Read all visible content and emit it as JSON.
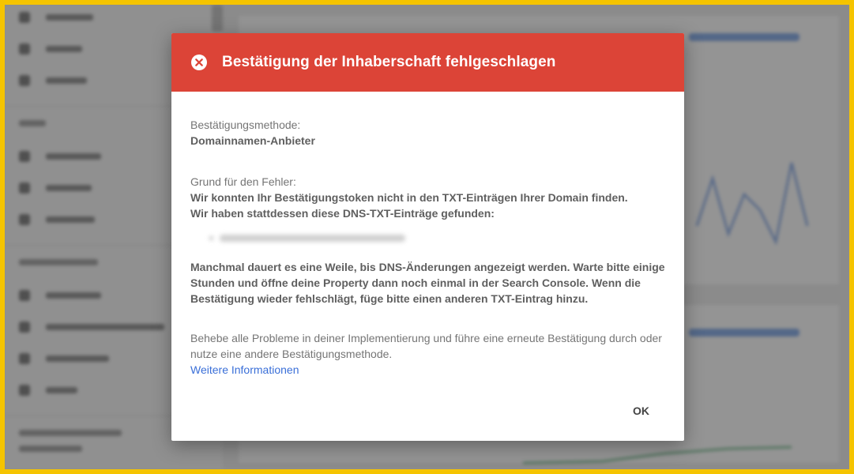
{
  "dialog": {
    "title": "Bestätigung der Inhaberschaft fehlgeschlagen",
    "method_label": "Bestätigungsmethode:",
    "method_value": "Domainnamen-Anbieter",
    "reason_label": "Grund für den Fehler:",
    "reason_line1": "Wir konnten Ihr Bestätigungstoken nicht in den TXT-Einträgen Ihrer Domain finden.",
    "reason_line2": "Wir haben stattdessen diese DNS-TXT-Einträge gefunden:",
    "note": "Manchmal dauert es eine Weile, bis DNS-Änderungen angezeigt werden. Warte bitte einige Stunden und öffne deine Property dann noch einmal in der Search Console. Wenn die Bestätigung wieder fehlschlägt, füge bitte einen anderen TXT-Eintrag hinzu.",
    "advice": "Behebe alle Probleme in deiner Implementierung und führe eine erneute Bestätigung durch oder nutze eine andere Bestätigungsmethode.",
    "more_info_link": "Weitere Informationen",
    "ok_label": "OK"
  },
  "colors": {
    "header": "#dc4437",
    "link": "#3a6fd8",
    "frame": "#f5c400"
  }
}
